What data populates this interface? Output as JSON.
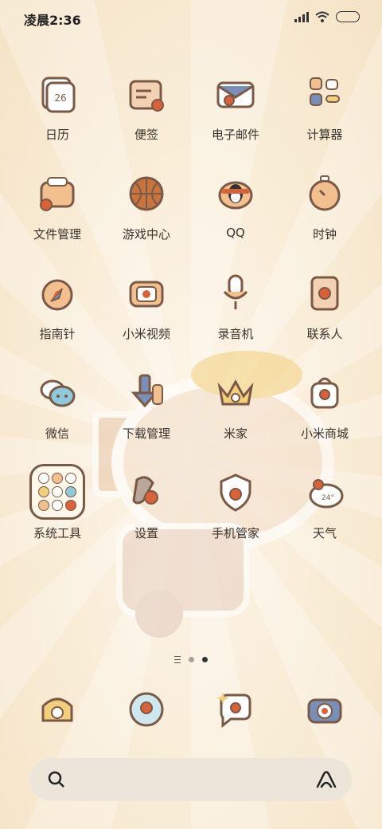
{
  "status_bar": {
    "time": "凌晨2:36"
  },
  "apps": [
    {
      "label": "日历",
      "icon": "calendar-icon",
      "badge": "26"
    },
    {
      "label": "便签",
      "icon": "notes-icon"
    },
    {
      "label": "电子邮件",
      "icon": "email-icon"
    },
    {
      "label": "计算器",
      "icon": "calculator-icon"
    },
    {
      "label": "文件管理",
      "icon": "file-manager-icon"
    },
    {
      "label": "游戏中心",
      "icon": "game-center-icon"
    },
    {
      "label": "QQ",
      "icon": "qq-icon"
    },
    {
      "label": "时钟",
      "icon": "clock-icon"
    },
    {
      "label": "指南针",
      "icon": "compass-icon"
    },
    {
      "label": "小米视频",
      "icon": "video-icon"
    },
    {
      "label": "录音机",
      "icon": "recorder-icon"
    },
    {
      "label": "联系人",
      "icon": "contacts-icon"
    },
    {
      "label": "微信",
      "icon": "wechat-icon"
    },
    {
      "label": "下载管理",
      "icon": "download-icon"
    },
    {
      "label": "米家",
      "icon": "mijia-icon"
    },
    {
      "label": "小米商城",
      "icon": "mi-store-icon"
    },
    {
      "label": "系统工具",
      "icon": "folder-icon"
    },
    {
      "label": "设置",
      "icon": "settings-icon"
    },
    {
      "label": "手机管家",
      "icon": "security-icon"
    },
    {
      "label": "天气",
      "icon": "weather-icon",
      "badge": "24°"
    }
  ],
  "dock": [
    {
      "icon": "phone-icon"
    },
    {
      "icon": "browser-icon"
    },
    {
      "icon": "messages-icon"
    },
    {
      "icon": "camera-icon"
    }
  ],
  "page_indicator": {
    "pages": 3,
    "active": 3
  },
  "colors": {
    "outline": "#7a5a46",
    "apple": "#d9623b",
    "cream": "#fbf2e2",
    "peach": "#f2c08f"
  }
}
